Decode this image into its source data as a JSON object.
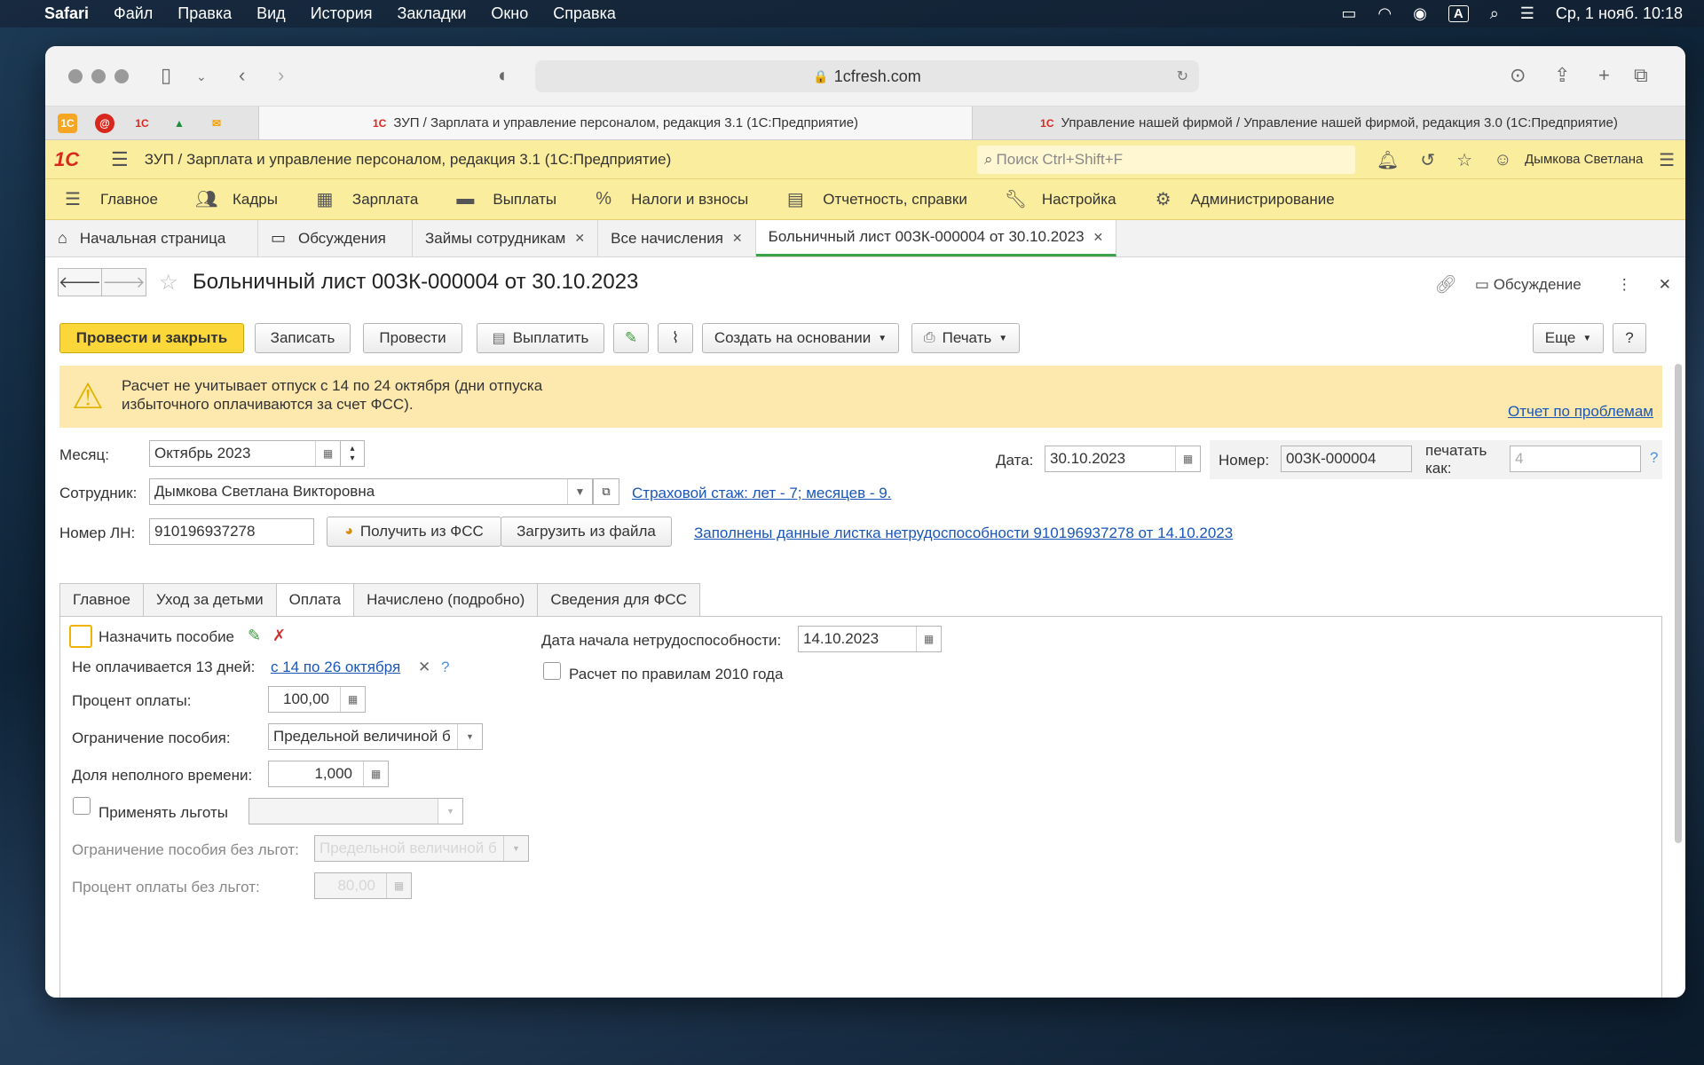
{
  "menubar": {
    "app": "Safari",
    "items": [
      "Файл",
      "Правка",
      "Вид",
      "История",
      "Закладки",
      "Окно",
      "Справка"
    ],
    "clock": "Ср, 1 нояб. 10:18"
  },
  "browser": {
    "url": "1cfresh.com",
    "tabs": [
      "ЗУП / Зарплата и управление персоналом, редакция 3.1 (1С:Предприятие)",
      "Управление нашей фирмой / Управление нашей фирмой, редакция 3.0 (1С:Предприятие)"
    ]
  },
  "app": {
    "title": "ЗУП / Зарплата и управление персоналом, редакция 3.1  (1С:Предприятие)",
    "search_placeholder": "Поиск Ctrl+Shift+F",
    "user": "Дымкова Светлана",
    "sections": [
      "Главное",
      "Кадры",
      "Зарплата",
      "Выплаты",
      "Налоги и взносы",
      "Отчетность, справки",
      "Настройка",
      "Администрирование"
    ],
    "open_tabs": [
      "Начальная страница",
      "Обсуждения",
      "Займы сотрудникам",
      "Все начисления",
      "Больничный лист 00ЗК-000004 от 30.10.2023"
    ]
  },
  "doc": {
    "title": "Больничный лист 00ЗК-000004 от 30.10.2023",
    "discussion": "Обсуждение",
    "buttons": {
      "post_close": "Провести и закрыть",
      "save": "Записать",
      "post": "Провести",
      "pay": "Выплатить",
      "create_based": "Создать на основании",
      "print": "Печать",
      "more": "Еще",
      "help": "?"
    },
    "alert": {
      "message": "Расчет не учитывает отпуск с 14 по 24 октября (дни отпуска избыточного оплачиваются за счет ФСС).",
      "link": "Отчет по проблемам"
    },
    "header": {
      "month_label": "Месяц:",
      "month_value": "Октябрь 2023",
      "date_label": "Дата:",
      "date_value": "30.10.2023",
      "number_label": "Номер:",
      "number_value": "00ЗК-000004",
      "print_as_label1": "печатать",
      "print_as_label2": "как:",
      "print_as_value": "4",
      "employee_label": "Сотрудник:",
      "employee_value": "Дымкова Светлана Викторовна",
      "insurance_link": "Страховой стаж: лет - 7; месяцев - 9.",
      "ln_label": "Номер ЛН:",
      "ln_value": "910196937278",
      "get_fss": "Получить из ФСС",
      "load_file": "Загрузить из файла",
      "filled_link": "Заполнены данные листка нетрудоспособности 910196937278 от 14.10.2023"
    },
    "form_tabs": [
      "Главное",
      "Уход за детьми",
      "Оплата",
      "Начислено (подробно)",
      "Сведения для ФСС"
    ],
    "payment": {
      "assign_benefit": "Назначить пособие",
      "not_paid_label": "Не оплачивается 13 дней:",
      "not_paid_link": "с 14 по 26 октября",
      "percent_label": "Процент оплаты:",
      "percent_value": "100,00",
      "limit_label": "Ограничение пособия:",
      "limit_value": "Предельной величиной б",
      "parttime_label": "Доля неполного времени:",
      "parttime_value": "1,000",
      "apply_benefits": "Применять льготы",
      "limit_no_benefits_label": "Ограничение пособия без льгот:",
      "limit_no_benefits_value": "Предельной величиной б",
      "percent_no_benefits_label": "Процент оплаты без льгот:",
      "percent_no_benefits_value": "80,00",
      "start_date_label": "Дата начала нетрудоспособности:",
      "start_date_value": "14.10.2023",
      "rules_2010": "Расчет по правилам 2010 года"
    }
  }
}
